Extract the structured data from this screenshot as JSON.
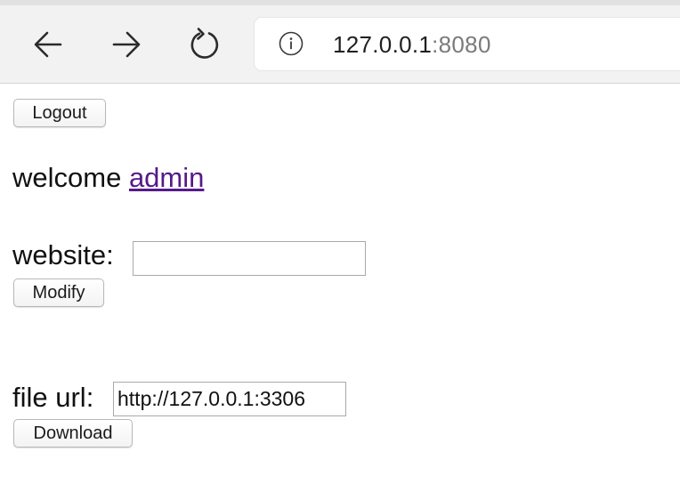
{
  "browser": {
    "url_host": "127.0.0.1",
    "url_port": ":8080",
    "back_icon": "arrow-left-icon",
    "forward_icon": "arrow-right-icon",
    "reload_icon": "reload-icon",
    "site_info_icon": "info-icon"
  },
  "page": {
    "logout_label": "Logout",
    "welcome_text": "welcome ",
    "username": "admin",
    "website_label": "website:",
    "website_value": "",
    "modify_label": "Modify",
    "file_url_label": "file url:",
    "file_url_value": "http://127.0.0.1:3306",
    "download_label": "Download"
  },
  "colors": {
    "link_visited": "#551a8b",
    "toolbar_bg": "#f2f2f2"
  }
}
